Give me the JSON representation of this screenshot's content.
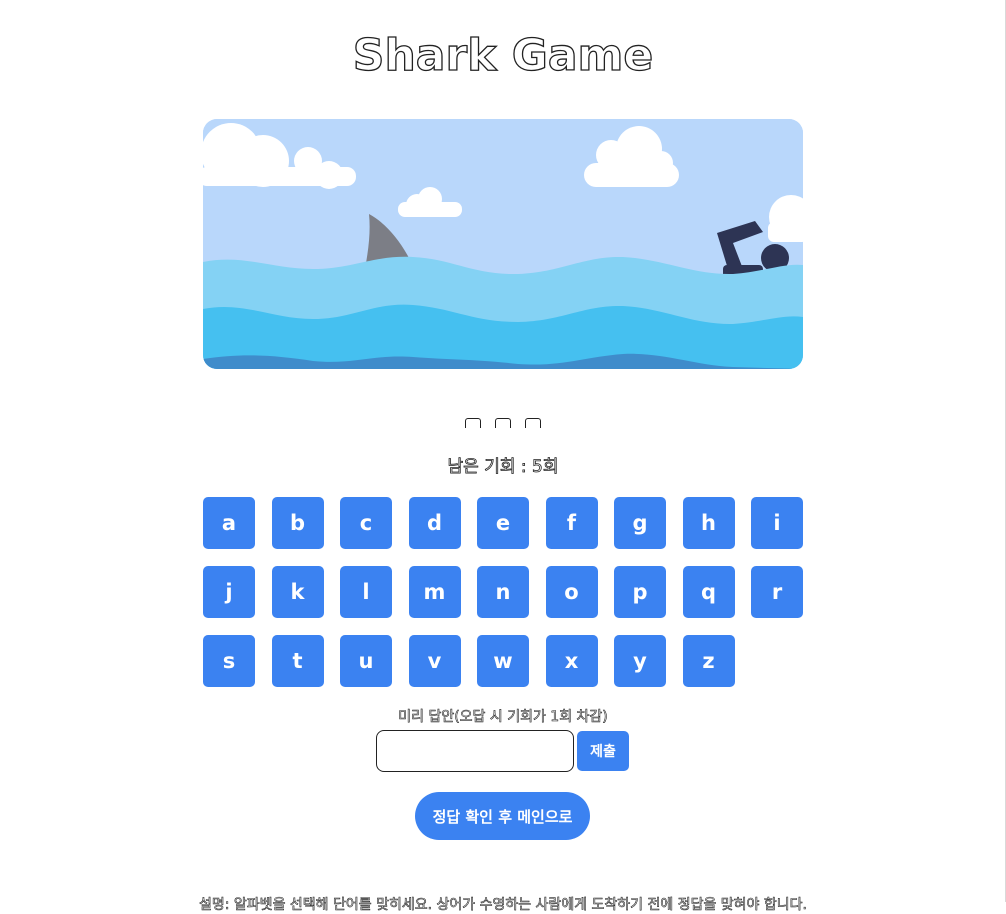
{
  "game": {
    "title": "Shark Game",
    "word_slots": 3,
    "chances_text": "남은 기회 : 5회",
    "keys": [
      "a",
      "b",
      "c",
      "d",
      "e",
      "f",
      "g",
      "h",
      "i",
      "j",
      "k",
      "l",
      "m",
      "n",
      "o",
      "p",
      "q",
      "r",
      "s",
      "t",
      "u",
      "v",
      "w",
      "x",
      "y",
      "z"
    ],
    "guess_label": "미리 답안(오답 시 기회가 1회 차감)",
    "guess_input_value": "",
    "submit_label": "제출",
    "main_button_label": "정답 확인 후 메인으로",
    "footer_text": "설명: 알파벳을 선택해 단어를 맞히세요. 상어가 수영하는 사람에게 도착하기 전에 정답을 맞혀야 합니다."
  },
  "colors": {
    "sky": "#b9d7fb",
    "wave_light": "#84d2f4",
    "wave_mid": "#45c0f0",
    "wave_deep": "#3f8ccb",
    "shark_fin": "#7c7e86",
    "swimmer": "#2d3454",
    "button": "#3b82f1",
    "cloud": "#ffffff"
  }
}
